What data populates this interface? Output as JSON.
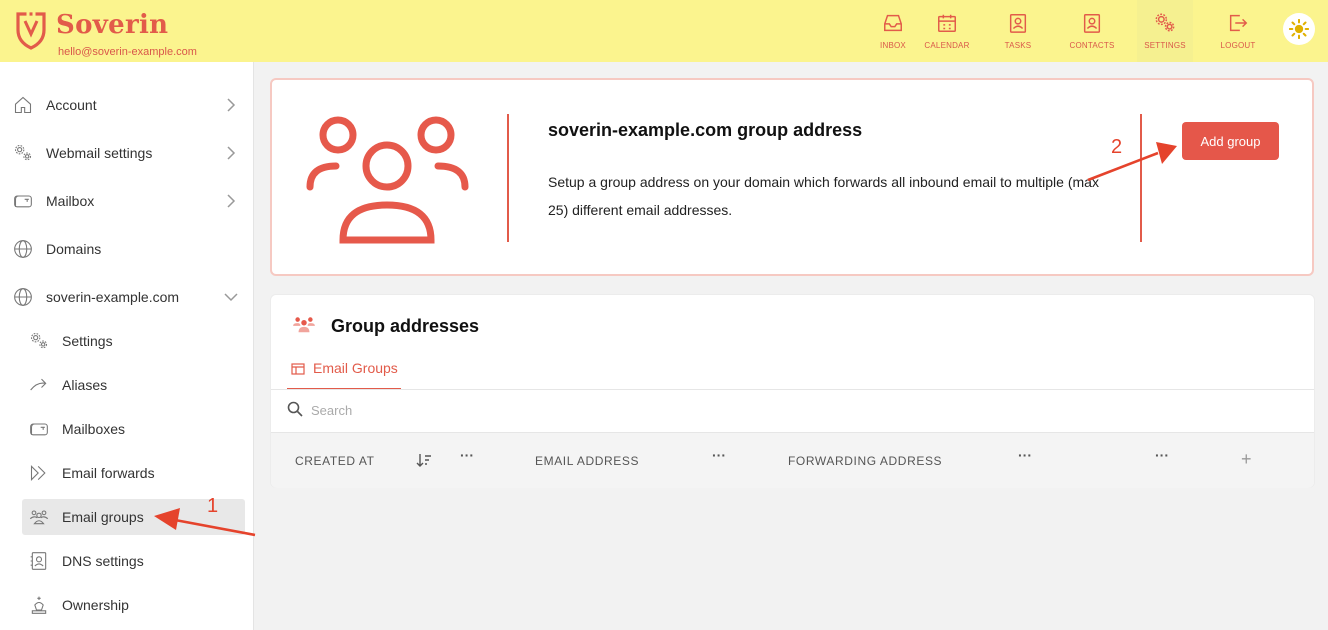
{
  "brand": {
    "name": "Soverin",
    "email": "hello@soverin-example.com",
    "color": "#e25b4a"
  },
  "topnav": [
    {
      "label": "INBOX",
      "icon": "inbox-icon"
    },
    {
      "label": "CALENDAR",
      "icon": "calendar-icon"
    },
    {
      "label": "TASKS",
      "icon": "tasks-icon"
    },
    {
      "label": "CONTACTS",
      "icon": "contacts-icon"
    },
    {
      "label": "SETTINGS",
      "icon": "settings-icon",
      "active": true
    },
    {
      "label": "LOGOUT",
      "icon": "logout-icon"
    }
  ],
  "sidebar": {
    "items": [
      {
        "label": "Account",
        "icon": "house-icon"
      },
      {
        "label": "Webmail settings",
        "icon": "gears-icon"
      },
      {
        "label": "Mailbox",
        "icon": "mailbox-icon"
      },
      {
        "label": "Domains",
        "icon": "globe-icon"
      },
      {
        "label": "soverin-example.com",
        "icon": "globe-icon"
      }
    ],
    "subitems": [
      {
        "label": "Settings",
        "icon": "gears-icon"
      },
      {
        "label": "Aliases",
        "icon": "arrow-icon"
      },
      {
        "label": "Mailboxes",
        "icon": "mailbox-icon"
      },
      {
        "label": "Email forwards",
        "icon": "forward-icon"
      },
      {
        "label": "Email groups",
        "icon": "group-icon",
        "selected": true
      },
      {
        "label": "DNS settings",
        "icon": "dns-icon"
      },
      {
        "label": "Ownership",
        "icon": "crown-icon"
      }
    ]
  },
  "info_card": {
    "title": "soverin-example.com group address",
    "description": "Setup a group address on your domain which forwards all inbound email to multiple (max 25) different email addresses.",
    "button": "Add group"
  },
  "groups_card": {
    "title": "Group addresses",
    "tab": "Email Groups",
    "search_placeholder": "Search",
    "columns": [
      "CREATED AT",
      "EMAIL ADDRESS",
      "FORWARDING ADDRESS"
    ],
    "column_menu": "···",
    "add_column": "+"
  },
  "annotations": {
    "one": "1",
    "two": "2",
    "color": "#e5432c"
  }
}
